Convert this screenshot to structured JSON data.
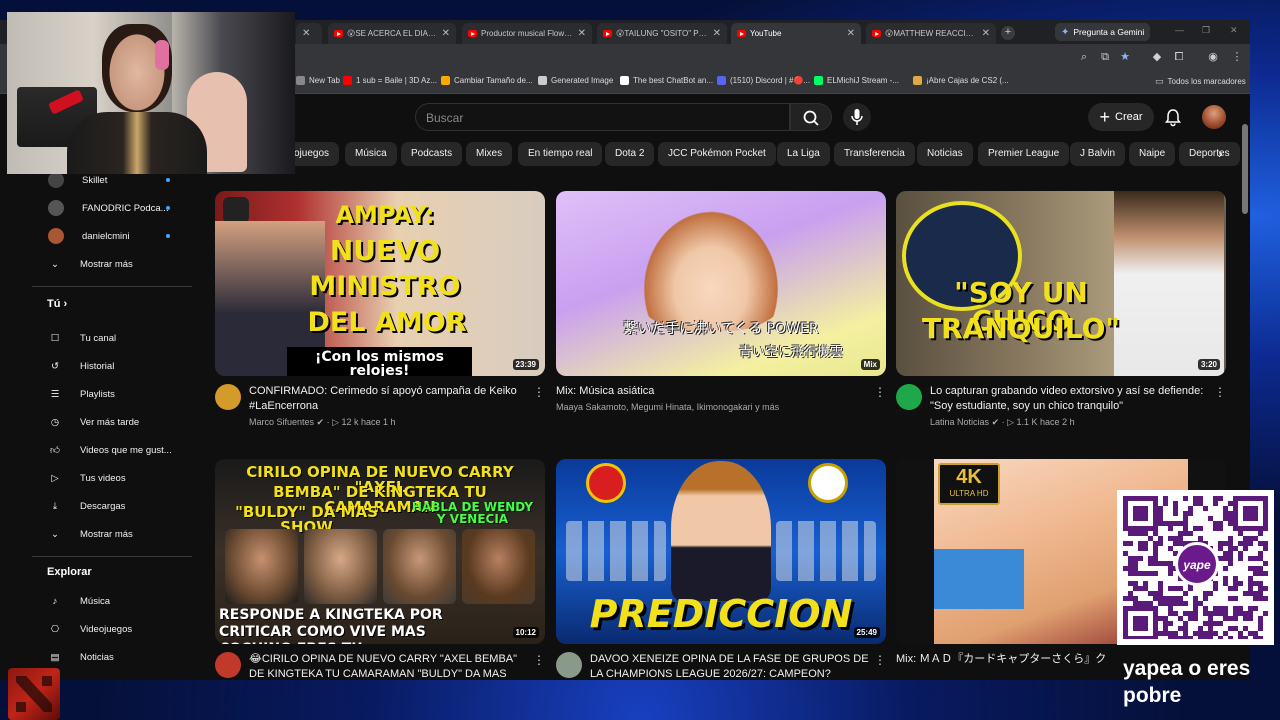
{
  "browser": {
    "tabs": [
      {
        "label": "",
        "active": false
      },
      {
        "label": "😮SE ACERCA EL DIA!😮",
        "active": false
      },
      {
        "label": "Productor musical Flow La",
        "active": false
      },
      {
        "label": "😮TAILUNG \"OSITO\" PRE",
        "active": false
      },
      {
        "label": "YouTube",
        "active": true
      },
      {
        "label": "😮MATTHEW REACCIONA",
        "active": false
      }
    ],
    "new_tab": "+",
    "gemini_label": "Pregunta a Gemini",
    "bookmarks": [
      {
        "label": "New Tab",
        "color": "#888888"
      },
      {
        "label": "1 sub = Baile | 3D Az...",
        "color": "#ff0000"
      },
      {
        "label": "Cambiar Tamaño de...",
        "color": "#ffaa00"
      },
      {
        "label": "Generated Image",
        "color": "#cccccc"
      },
      {
        "label": "The best ChatBot an...",
        "color": "#ffffff"
      },
      {
        "label": "(1510) Discord | #🔴...",
        "color": "#5865f2"
      },
      {
        "label": "ELMichiJ Stream -...",
        "color": "#00ff66"
      },
      {
        "label": "¡Abre Cajas de CS2 (...",
        "color": "#ddaa44"
      }
    ],
    "all_bookmarks": "Todos los marcadores"
  },
  "youtube": {
    "search_placeholder": "Buscar",
    "create_label": "Crear",
    "chips": [
      "ojuegos",
      "Música",
      "Podcasts",
      "Mixes",
      "En tiempo real",
      "Dota 2",
      "JCC Pokémon Pocket",
      "La Liga",
      "Transferencia",
      "Noticias",
      "Premier League",
      "J Balvin",
      "Naipe",
      "Deportes"
    ],
    "sidebar": {
      "subs": [
        {
          "label": "Skillet",
          "color": "#444444"
        },
        {
          "label": "FANODRIC Podca...",
          "color": "#555555"
        },
        {
          "label": "danielcmini",
          "color": "#aa5533"
        }
      ],
      "show_more_1": "Mostrar más",
      "you_heading": "Tú",
      "you_items": [
        "Tu canal",
        "Historial",
        "Playlists",
        "Ver más tarde",
        "Videos que me gust...",
        "Tus videos",
        "Descargas",
        "Mostrar más"
      ],
      "explore_heading": "Explorar",
      "explore_items": [
        "Música",
        "Videojuegos",
        "Noticias"
      ]
    },
    "videos": [
      {
        "title": "CONFIRMADO: Cerimedo sí apoyó campaña de Keiko #LaEncerrona",
        "channel": "Marco Sifuentes",
        "verified": true,
        "stats": "▷ 12 k  hace 1 h",
        "duration": "23:39",
        "thumb_lines": [
          "AMPAY:",
          "NUEVO",
          "MINISTRO",
          "DEL AMOR"
        ],
        "thumb_caption": "¡Con los mismos relojes!",
        "avatar_color": "#d49a2a"
      },
      {
        "title": "Mix: Música asiática",
        "channel": "Maaya Sakamoto, Megumi Hinata, Ikimonogakari y más",
        "verified": false,
        "stats": "",
        "duration": "Mix",
        "thumb_lines": [
          "繋いだ手に沸いてくる POWER",
          "青い空に飛行機雲"
        ],
        "thumb_caption": "",
        "avatar_color": ""
      },
      {
        "title": "Lo capturan grabando video extorsivo y así se defiende: \"Soy estudiante, soy un chico tranquilo\"",
        "channel": "Latina Noticias",
        "verified": true,
        "stats": "▷ 1.1 K  hace 2 h",
        "duration": "3:20",
        "thumb_lines": [
          "\"SOY UN CHICO",
          "TRANQUILO\""
        ],
        "thumb_caption": "",
        "avatar_color": "#1fa84a"
      },
      {
        "title": "😂CIRILO OPINA DE NUEVO CARRY \"AXEL BEMBA\" DE KINGTEKA TU CAMARAMAN \"BULDY\" DA MAS SHO",
        "channel": "",
        "verified": false,
        "stats": "",
        "duration": "10:12",
        "thumb_lines": [
          "CIRILO OPINA DE NUEVO CARRY \"AXEL",
          "BEMBA\" DE KINGTEKA TU CAMARAMAN",
          "\"BULDY\" DA MAS SHOW"
        ],
        "thumb_caption": "RESPONDE A KINGTEKA POR CRITICAR COMO VIVE MAS COCHINO ERES TU",
        "thumb_side": "HABLA DE WENDY Y VENECIA",
        "avatar_color": "#c0392b"
      },
      {
        "title": "DAVOO XENEIZE OPINA DE LA FASE DE GRUPOS DE LA CHAMPIONS LEAGUE 2026/27: CAMPEON?",
        "channel": "",
        "verified": false,
        "stats": "",
        "duration": "25:49",
        "thumb_lines": [
          "PREDICCION"
        ],
        "thumb_caption": "",
        "avatar_color": "#8a9a8a"
      },
      {
        "title": "Mix: ＭＡＤ『カードキャプターさくら』ク",
        "channel": "",
        "verified": false,
        "stats": "",
        "duration": "",
        "thumb_lines": [
          "4K",
          "ULTRA HD"
        ],
        "thumb_caption": "",
        "avatar_color": ""
      }
    ]
  },
  "overlay": {
    "yape_text": "yapea o eres pobre",
    "qr_label": "yape"
  }
}
